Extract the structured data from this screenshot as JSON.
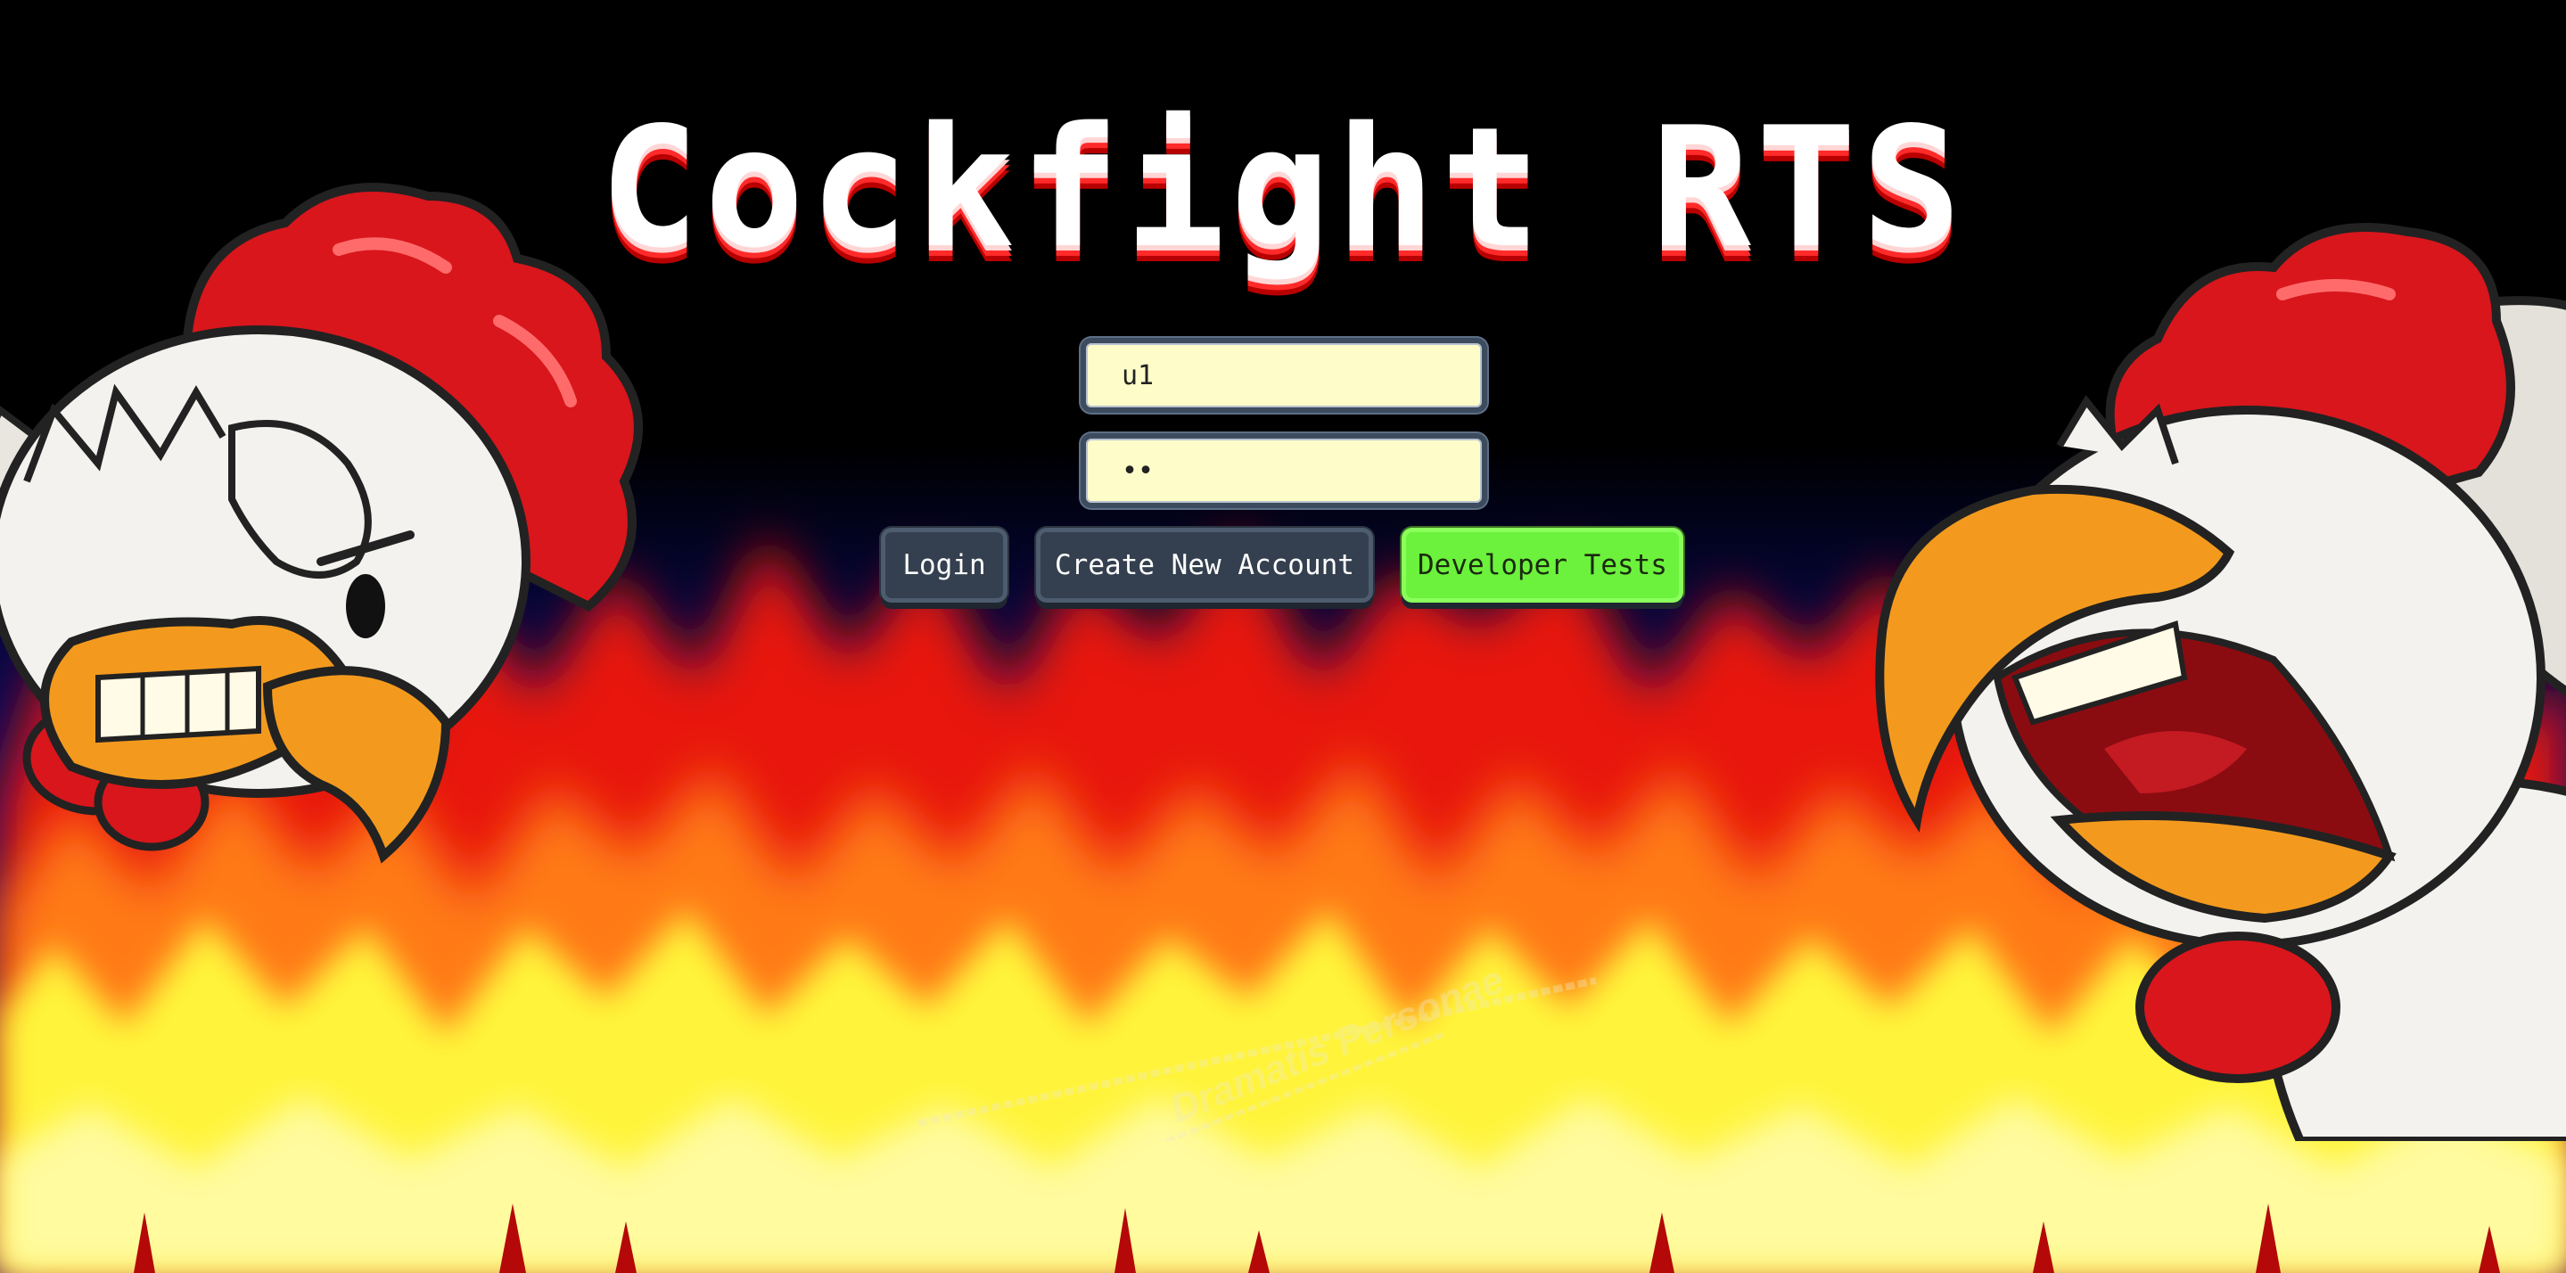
{
  "title": "Cockfight RTS",
  "login_form": {
    "username_value": "u1",
    "password_value": "••"
  },
  "buttons": {
    "login": "Login",
    "create_account": "Create New Account",
    "developer_tests": "Developer Tests"
  },
  "watermark_text": "Dramatis Personae",
  "colors": {
    "background": "#000000",
    "field_bg": "#fefcc8",
    "button_bg": "#34404f",
    "dev_button_bg": "#6cf23c",
    "fire_red": "#e8120a",
    "fire_yellow": "#fff43a",
    "title_shadow": "#ff2a2a"
  },
  "icons": {
    "left_character": "angry-rooster-left-icon",
    "right_character": "angry-rooster-right-icon"
  }
}
